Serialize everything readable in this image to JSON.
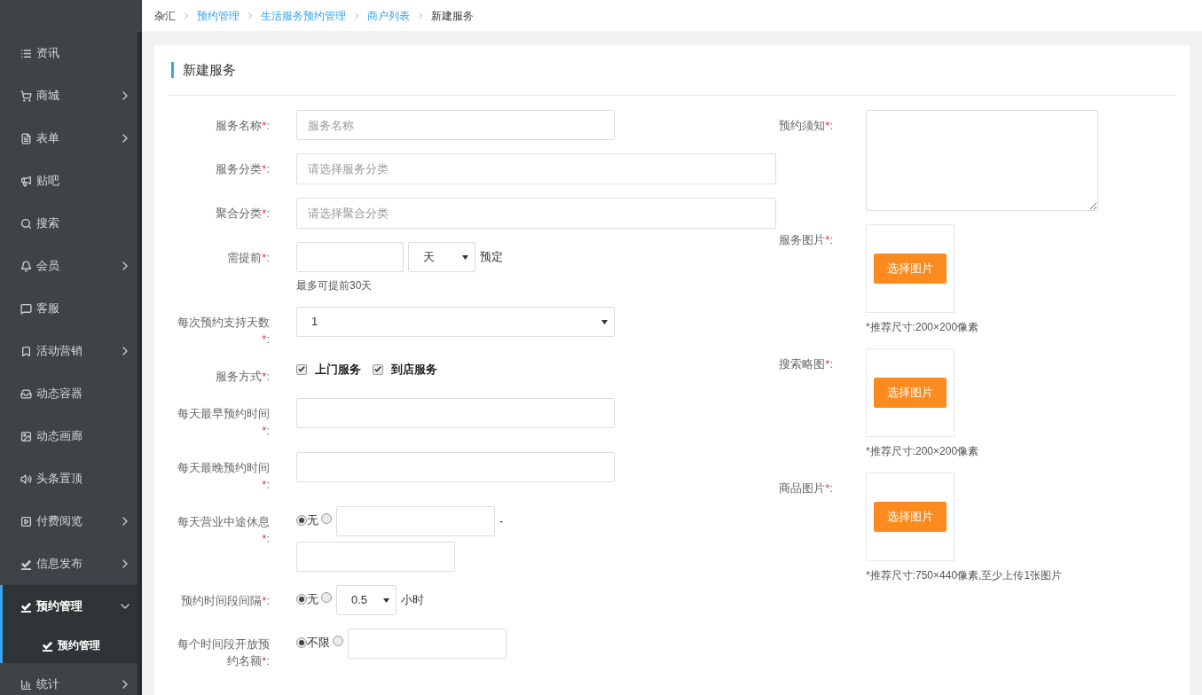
{
  "sidebar": {
    "items": [
      {
        "label": "资讯",
        "kind": "link",
        "selected": false
      },
      {
        "label": "商城",
        "kind": "group",
        "expanded": false,
        "selected": false
      },
      {
        "label": "表单",
        "kind": "group",
        "expanded": false,
        "selected": false
      },
      {
        "label": "贴吧",
        "kind": "link",
        "selected": false
      },
      {
        "label": "搜索",
        "kind": "link",
        "selected": false
      },
      {
        "label": "会员",
        "kind": "group",
        "expanded": false,
        "selected": false
      },
      {
        "label": "客服",
        "kind": "link",
        "selected": false
      },
      {
        "label": "活动营销",
        "kind": "group",
        "expanded": false,
        "selected": false
      },
      {
        "label": "动态容器",
        "kind": "link",
        "selected": false
      },
      {
        "label": "动态画廊",
        "kind": "link",
        "selected": false
      },
      {
        "label": "头条置顶",
        "kind": "link",
        "selected": false
      },
      {
        "label": "付费阅览",
        "kind": "group",
        "expanded": false,
        "selected": false
      },
      {
        "label": "信息发布",
        "kind": "group",
        "expanded": false,
        "selected": false
      },
      {
        "label": "预约管理",
        "kind": "group",
        "expanded": true,
        "selected": true,
        "children": [
          {
            "label": "预约管理",
            "selected": true
          }
        ]
      },
      {
        "label": "统计",
        "kind": "group",
        "expanded": false,
        "selected": false
      }
    ]
  },
  "breadcrumb": [
    {
      "label": "杂汇",
      "link": false
    },
    {
      "label": "预约管理",
      "link": true
    },
    {
      "label": "生活服务预约管理",
      "link": true
    },
    {
      "label": "商户列表",
      "link": true
    },
    {
      "label": "新建服务",
      "link": false
    }
  ],
  "card": {
    "title": "新建服务",
    "left_fields": [
      {
        "label": "服务名称",
        "mark": "*",
        "colon": ":",
        "controls": [
          {
            "kind": "field",
            "placeholder": "服务名称"
          }
        ]
      },
      {
        "label": "服务分类",
        "mark": "*",
        "colon": ":",
        "controls": [
          {
            "kind": "picker",
            "placeholder": "请选择服务分类"
          }
        ]
      },
      {
        "label": "聚合分类",
        "mark": "*",
        "colon": ":",
        "controls": [
          {
            "kind": "picker",
            "placeholder": "请选择聚合分类"
          }
        ]
      },
      {
        "label": "需提前",
        "mark": "*",
        "colon": ":",
        "controls": [
          {
            "kind": "short_field"
          },
          {
            "kind": "unit_select",
            "value": "天"
          },
          {
            "kind": "text",
            "text": "预定"
          }
        ],
        "below": [
          {
            "kind": "hint",
            "text": "最多可提前30天"
          }
        ]
      },
      {
        "label": "每次预约支持天数",
        "mark": "*",
        "colon": ":",
        "controls": [
          {
            "kind": "select",
            "value": "1"
          }
        ]
      },
      {
        "label": "服务方式",
        "mark": "*",
        "colon": ":",
        "controls": [
          {
            "kind": "checkbox",
            "label": "上门服务",
            "checked": true
          },
          {
            "kind": "checkbox",
            "label": "到店服务",
            "checked": true
          }
        ]
      },
      {
        "label": "每天最早预约时间",
        "mark": "*",
        "colon": ":",
        "controls": [
          {
            "kind": "field"
          }
        ]
      },
      {
        "label": "每天最晚预约时间",
        "mark": "*",
        "colon": ":",
        "controls": [
          {
            "kind": "field"
          }
        ]
      },
      {
        "label": "每天营业中途休息",
        "mark": "*",
        "colon": ":",
        "controls": [
          {
            "kind": "radio",
            "label": "无",
            "selected": true
          },
          {
            "kind": "radio",
            "selected": false
          },
          {
            "kind": "range_field"
          },
          {
            "kind": "text",
            "text": "-"
          }
        ],
        "below": [
          {
            "kind": "range_field"
          }
        ]
      },
      {
        "label": "预约时间段间隔",
        "mark": "*",
        "colon": ":",
        "controls": [
          {
            "kind": "radio",
            "label": "无",
            "selected": true
          },
          {
            "kind": "radio",
            "selected": false
          },
          {
            "kind": "mini_select",
            "value": "0.5"
          },
          {
            "kind": "text",
            "text": "小时"
          }
        ]
      },
      {
        "label": "每个时间段开放预约名额",
        "mark": "*",
        "colon": ":",
        "controls": [
          {
            "kind": "radio",
            "label": "不限",
            "selected": true
          },
          {
            "kind": "radio",
            "selected": false
          },
          {
            "kind": "range_field"
          }
        ]
      }
    ],
    "right_fields": [
      {
        "label": "预约须知",
        "mark": "*",
        "colon": ":",
        "kind": "textarea"
      },
      {
        "label": "服务图片",
        "mark": "*",
        "colon": ":",
        "kind": "upload",
        "button": "选择图片",
        "hint": "*推荐尺寸:200×200像素"
      },
      {
        "label": "搜索略图",
        "mark": "*",
        "colon": ":",
        "kind": "upload",
        "button": "选择图片",
        "hint": "*推荐尺寸:200×200像素"
      },
      {
        "label": "商品图片",
        "mark": "*",
        "colon": ":",
        "kind": "upload",
        "button": "选择图片",
        "hint": "*推荐尺寸:750×440像素,至少上传1张图片"
      }
    ]
  }
}
